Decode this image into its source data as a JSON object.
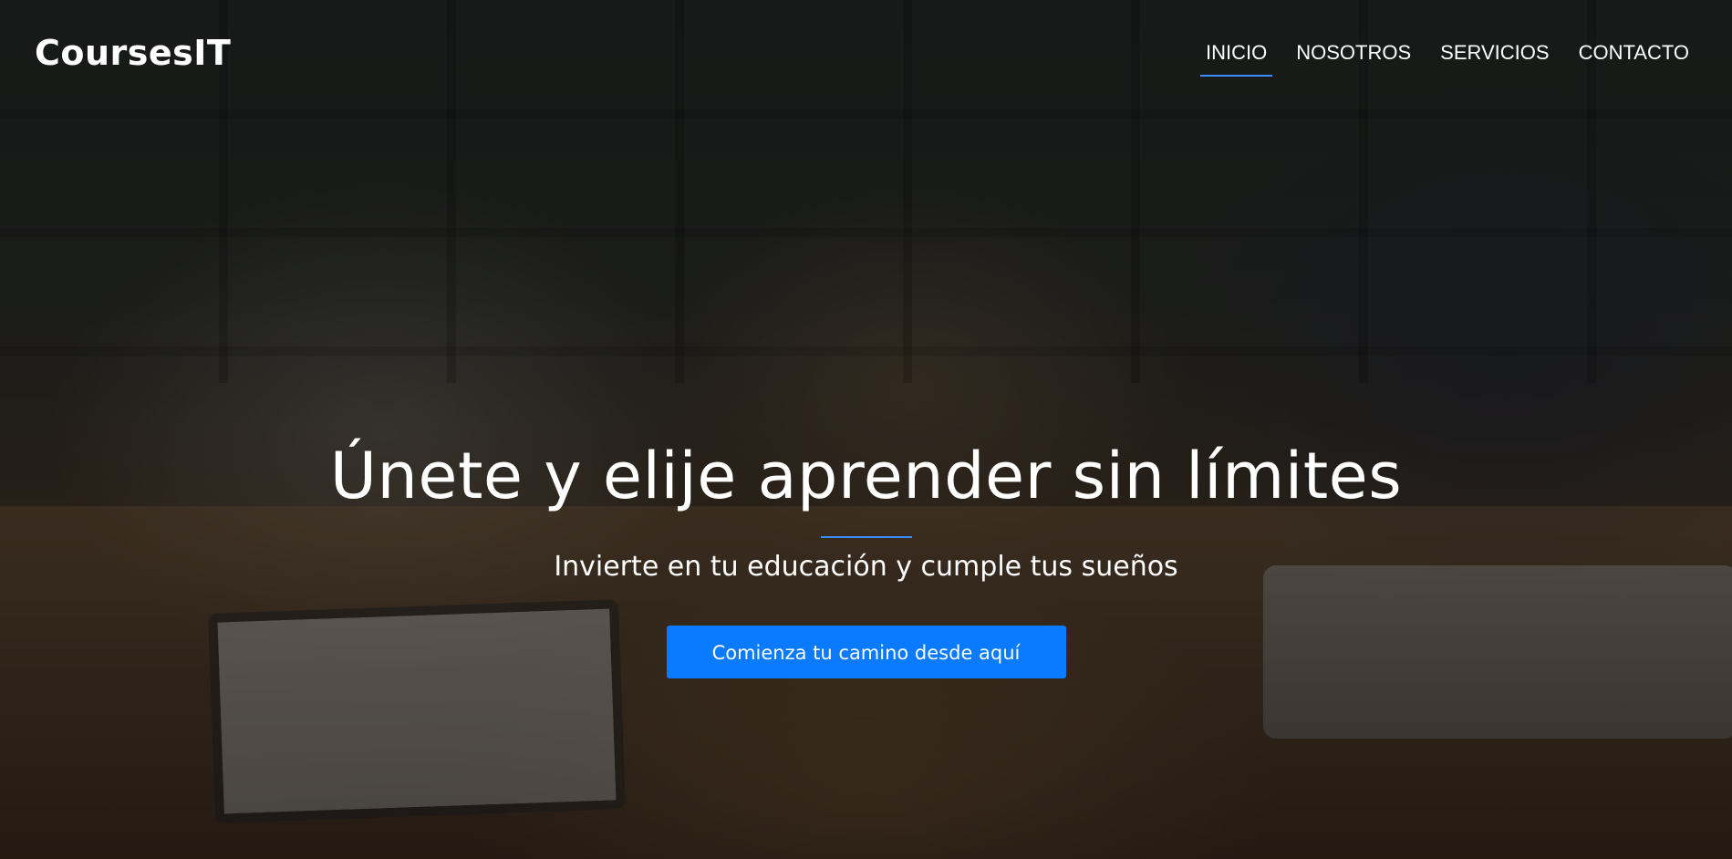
{
  "navbar": {
    "brand": "CoursesIT",
    "items": [
      {
        "label": "INICIO",
        "active": true
      },
      {
        "label": "NOSOTROS",
        "active": false
      },
      {
        "label": "SERVICIOS",
        "active": false
      },
      {
        "label": "CONTACTO",
        "active": false
      }
    ]
  },
  "hero": {
    "headline": "Únete y elije aprender sin límites",
    "subheadline": "Invierte en tu educación y cumple tus sueños",
    "cta_label": "Comienza tu camino desde aquí"
  },
  "colors": {
    "accent": "#0a7bff",
    "underline": "#3b8cff",
    "text": "#ffffff"
  }
}
